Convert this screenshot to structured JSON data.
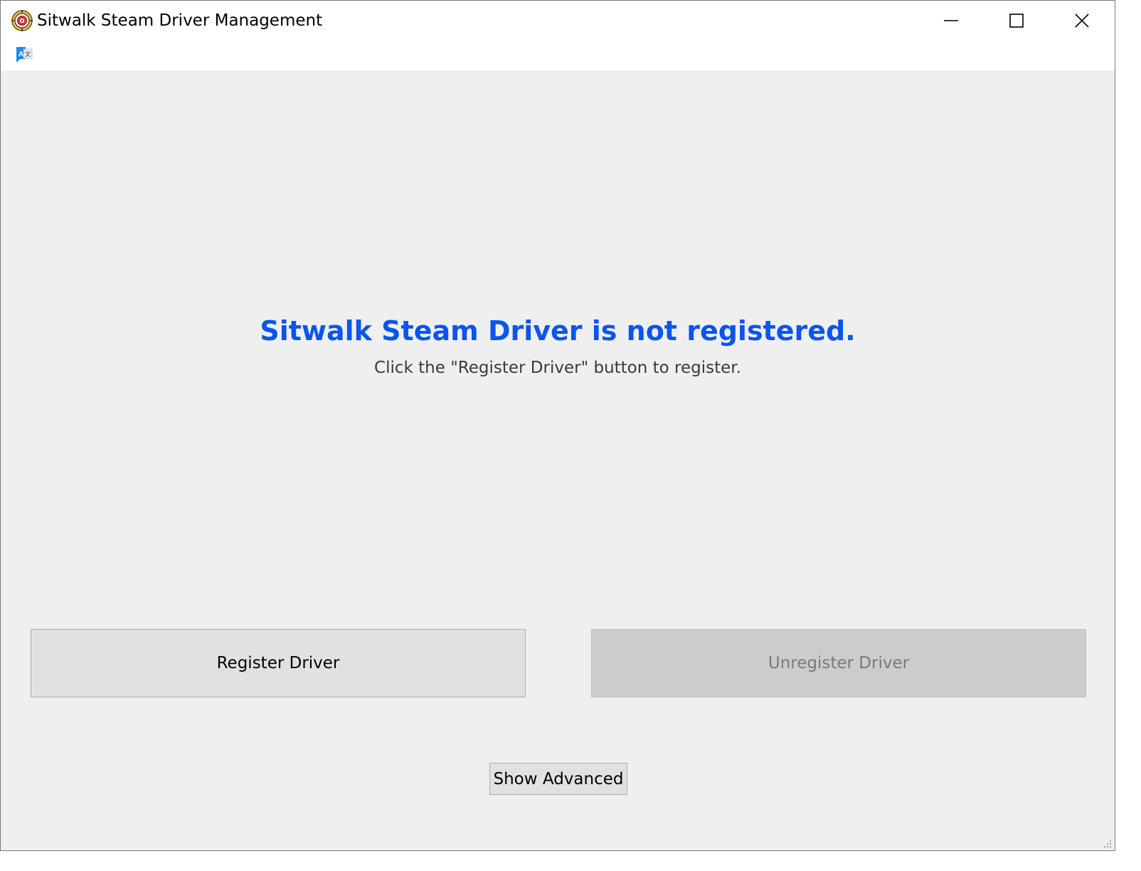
{
  "window": {
    "title": "Sitwalk Steam Driver Management",
    "app_icon": "gear-target-icon",
    "controls": {
      "minimize_icon": "minimize-icon",
      "maximize_icon": "maximize-icon",
      "close_icon": "close-icon"
    }
  },
  "toolbar": {
    "language_icon": "translate-icon"
  },
  "status": {
    "title": "Sitwalk Steam Driver is not registered.",
    "subtitle": "Click the \"Register Driver\" button to register.",
    "title_color": "#0b55ef"
  },
  "actions": {
    "register_label": "Register Driver",
    "unregister_label": "Unregister Driver",
    "unregister_enabled": false,
    "show_advanced_label": "Show Advanced"
  }
}
